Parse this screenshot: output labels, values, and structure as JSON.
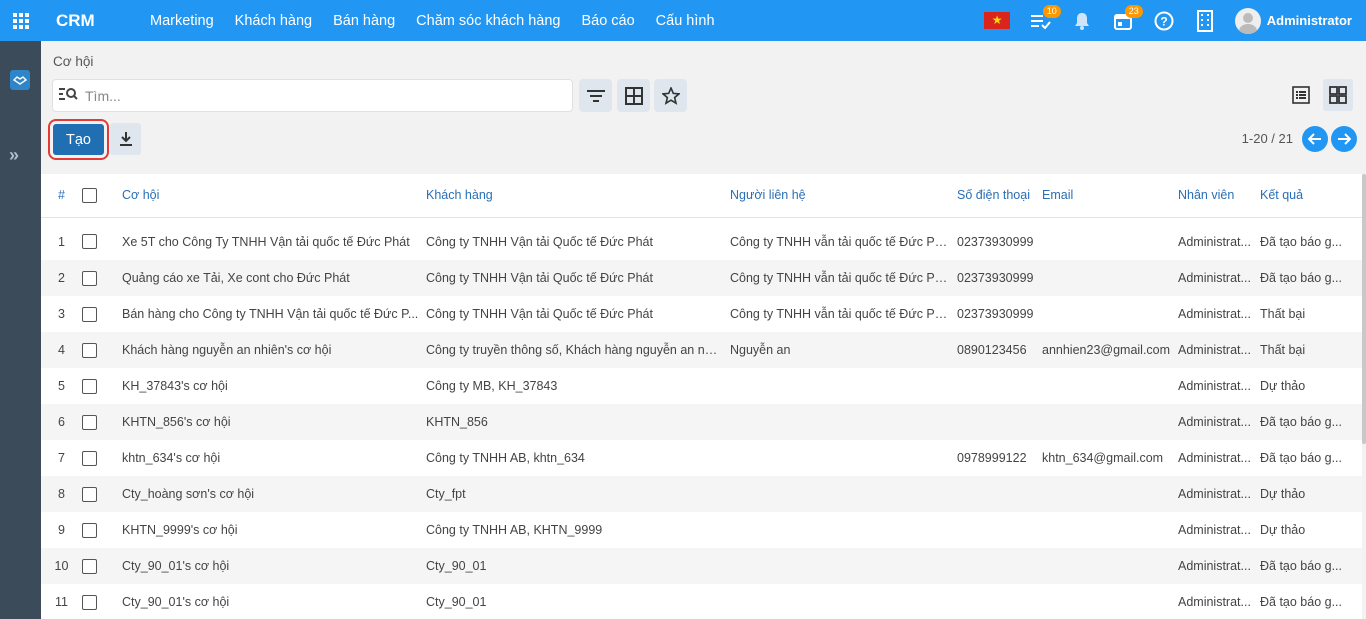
{
  "app": {
    "brand": "CRM"
  },
  "nav": [
    "Marketing",
    "Khách hàng",
    "Bán hàng",
    "Chăm sóc khách hàng",
    "Báo cáo",
    "Cấu hình"
  ],
  "header": {
    "tasks_badge": "10",
    "calendar_badge": "23",
    "user_name": "Administrator"
  },
  "breadcrumb": "Cơ hội",
  "search": {
    "placeholder": "Tìm..."
  },
  "toolbar": {
    "create_label": "Tạo"
  },
  "pager": {
    "text": "1-20 / 21"
  },
  "colors": {
    "topbar": "#2196f3",
    "sidebar": "#3c4b5a",
    "primary": "#1f6fb2",
    "header_text": "#2a6fb5"
  },
  "table": {
    "headers": {
      "num": "#",
      "opportunity": "Cơ hội",
      "customer": "Khách hàng",
      "contact": "Người liên hệ",
      "phone": "Số điện thoại",
      "email": "Email",
      "employee": "Nhân viên",
      "result": "Kết quả"
    },
    "rows": [
      {
        "num": "1",
        "opportunity": "Xe 5T cho Công Ty TNHH Vận tải quốc tế Đức Phát",
        "customer": "Công ty TNHH Vận tải Quốc tế Đức Phát",
        "contact": "Công ty TNHH vẫn tải quốc tế Đức Phát",
        "phone": "02373930999",
        "email": "",
        "employee": "Administrat...",
        "result": "Đã tạo báo g..."
      },
      {
        "num": "2",
        "opportunity": "Quảng cáo xe Tải, Xe cont cho Đức Phát",
        "customer": "Công ty TNHH Vận tải Quốc tế Đức Phát",
        "contact": "Công ty TNHH vẫn tải quốc tế Đức Phát",
        "phone": "02373930999",
        "email": "",
        "employee": "Administrat...",
        "result": "Đã tạo báo g..."
      },
      {
        "num": "3",
        "opportunity": "Bán hàng cho Công ty TNHH Vận tải quốc tế Đức P...",
        "customer": "Công ty TNHH Vận tải Quốc tế Đức Phát",
        "contact": "Công ty TNHH vẫn tải quốc tế Đức Phát",
        "phone": "02373930999",
        "email": "",
        "employee": "Administrat...",
        "result": "Thất bại"
      },
      {
        "num": "4",
        "opportunity": "Khách hàng nguyễn an nhiên's cơ hội",
        "customer": "Công ty truyền thông số, Khách hàng nguyễn an nhi...",
        "contact": "Nguyễn an",
        "phone": "0890123456",
        "email": "annhien23@gmail.com",
        "employee": "Administrat...",
        "result": "Thất bại"
      },
      {
        "num": "5",
        "opportunity": "KH_37843's cơ hội",
        "customer": "Công ty MB, KH_37843",
        "contact": "",
        "phone": "",
        "email": "",
        "employee": "Administrat...",
        "result": "Dự thảo"
      },
      {
        "num": "6",
        "opportunity": "KHTN_856's cơ hội",
        "customer": "KHTN_856",
        "contact": "",
        "phone": "",
        "email": "",
        "employee": "Administrat...",
        "result": "Đã tạo báo g..."
      },
      {
        "num": "7",
        "opportunity": "khtn_634's cơ hội",
        "customer": "Công ty TNHH AB, khtn_634",
        "contact": "",
        "phone": "0978999122",
        "email": "khtn_634@gmail.com",
        "employee": "Administrat...",
        "result": "Đã tạo báo g..."
      },
      {
        "num": "8",
        "opportunity": "Cty_hoàng sơn's cơ hội",
        "customer": "Cty_fpt",
        "contact": "",
        "phone": "",
        "email": "",
        "employee": "Administrat...",
        "result": "Dự thảo"
      },
      {
        "num": "9",
        "opportunity": "KHTN_9999's cơ hội",
        "customer": "Công ty TNHH AB, KHTN_9999",
        "contact": "",
        "phone": "",
        "email": "",
        "employee": "Administrat...",
        "result": "Dự thảo"
      },
      {
        "num": "10",
        "opportunity": "Cty_90_01's cơ hội",
        "customer": "Cty_90_01",
        "contact": "",
        "phone": "",
        "email": "",
        "employee": "Administrat...",
        "result": "Đã tạo báo g..."
      },
      {
        "num": "11",
        "opportunity": "Cty_90_01's cơ hội",
        "customer": "Cty_90_01",
        "contact": "",
        "phone": "",
        "email": "",
        "employee": "Administrat...",
        "result": "Đã tạo báo g..."
      }
    ]
  }
}
